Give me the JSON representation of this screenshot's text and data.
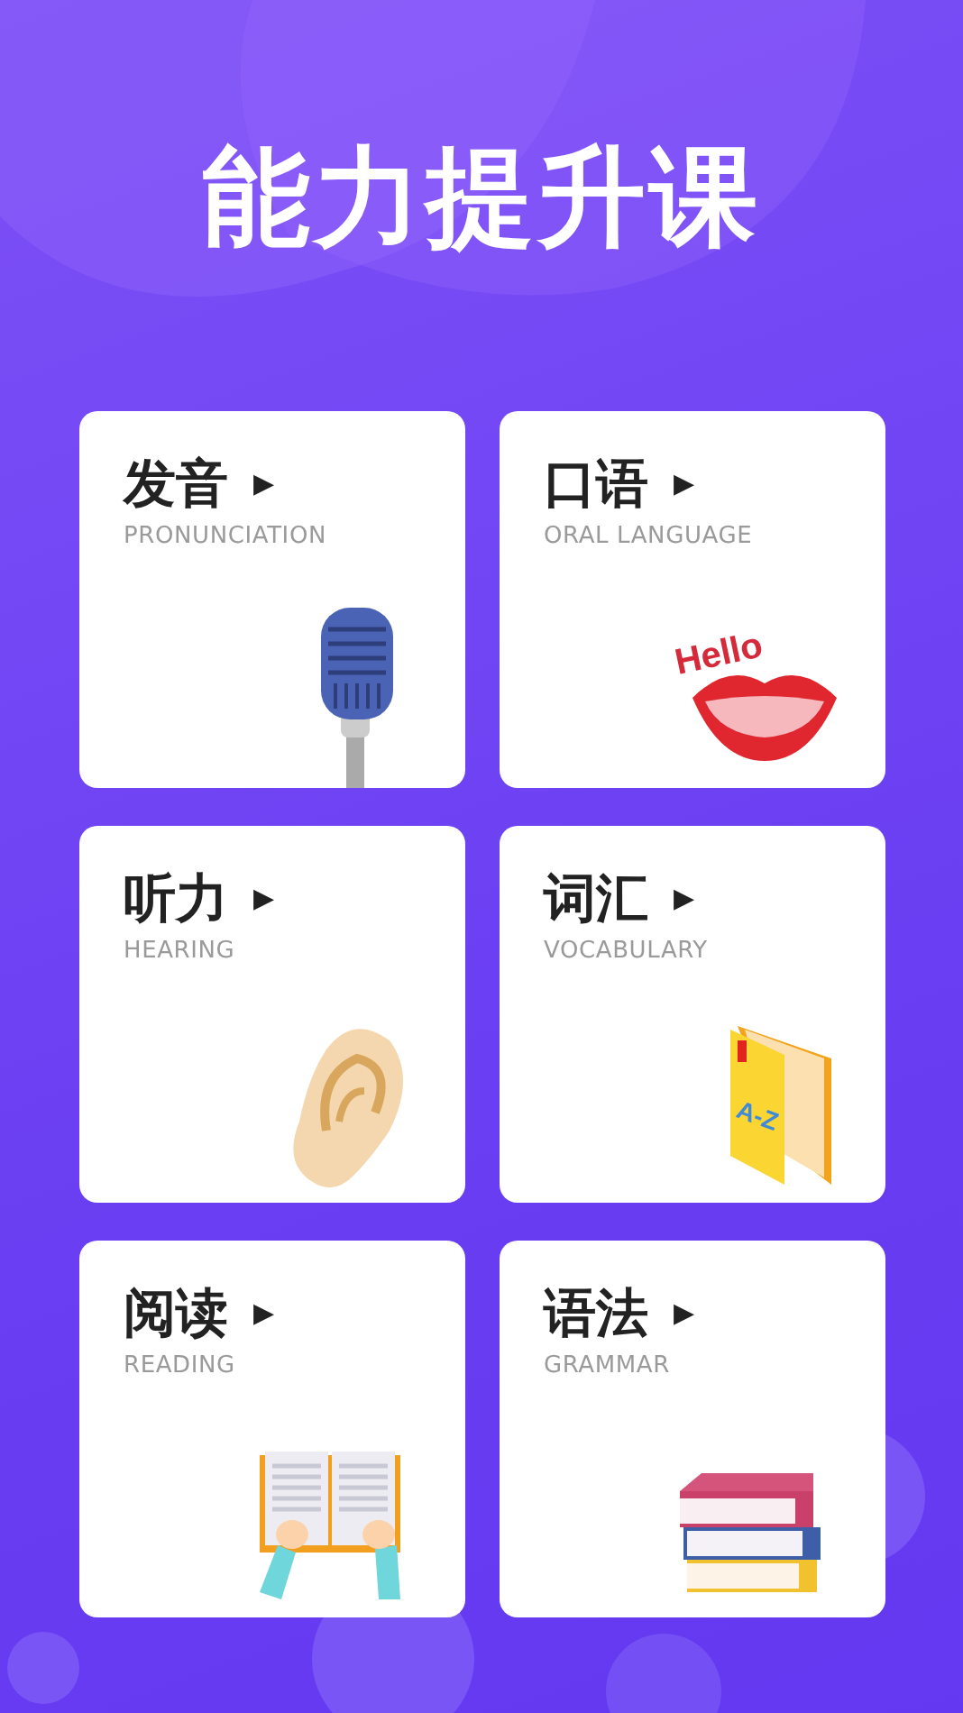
{
  "title": "能力提升课",
  "cards": [
    {
      "title": "发音",
      "arrow": "▶",
      "subtitle": "PRONUNCIATION",
      "kind": "microphone"
    },
    {
      "title": "口语",
      "arrow": "▶",
      "subtitle": "ORAL LANGUAGE",
      "kind": "lips",
      "illustration_text": "Hello"
    },
    {
      "title": "听力",
      "arrow": "▶",
      "subtitle": "HEARING",
      "kind": "ear"
    },
    {
      "title": "词汇",
      "arrow": "▶",
      "subtitle": "VOCABULARY",
      "kind": "dictionary",
      "illustration_text": "A-Z"
    },
    {
      "title": "阅读",
      "arrow": "▶",
      "subtitle": "READING",
      "kind": "open-book"
    },
    {
      "title": "语法",
      "arrow": "▶",
      "subtitle": "GRAMMAR",
      "kind": "book-stack"
    }
  ]
}
